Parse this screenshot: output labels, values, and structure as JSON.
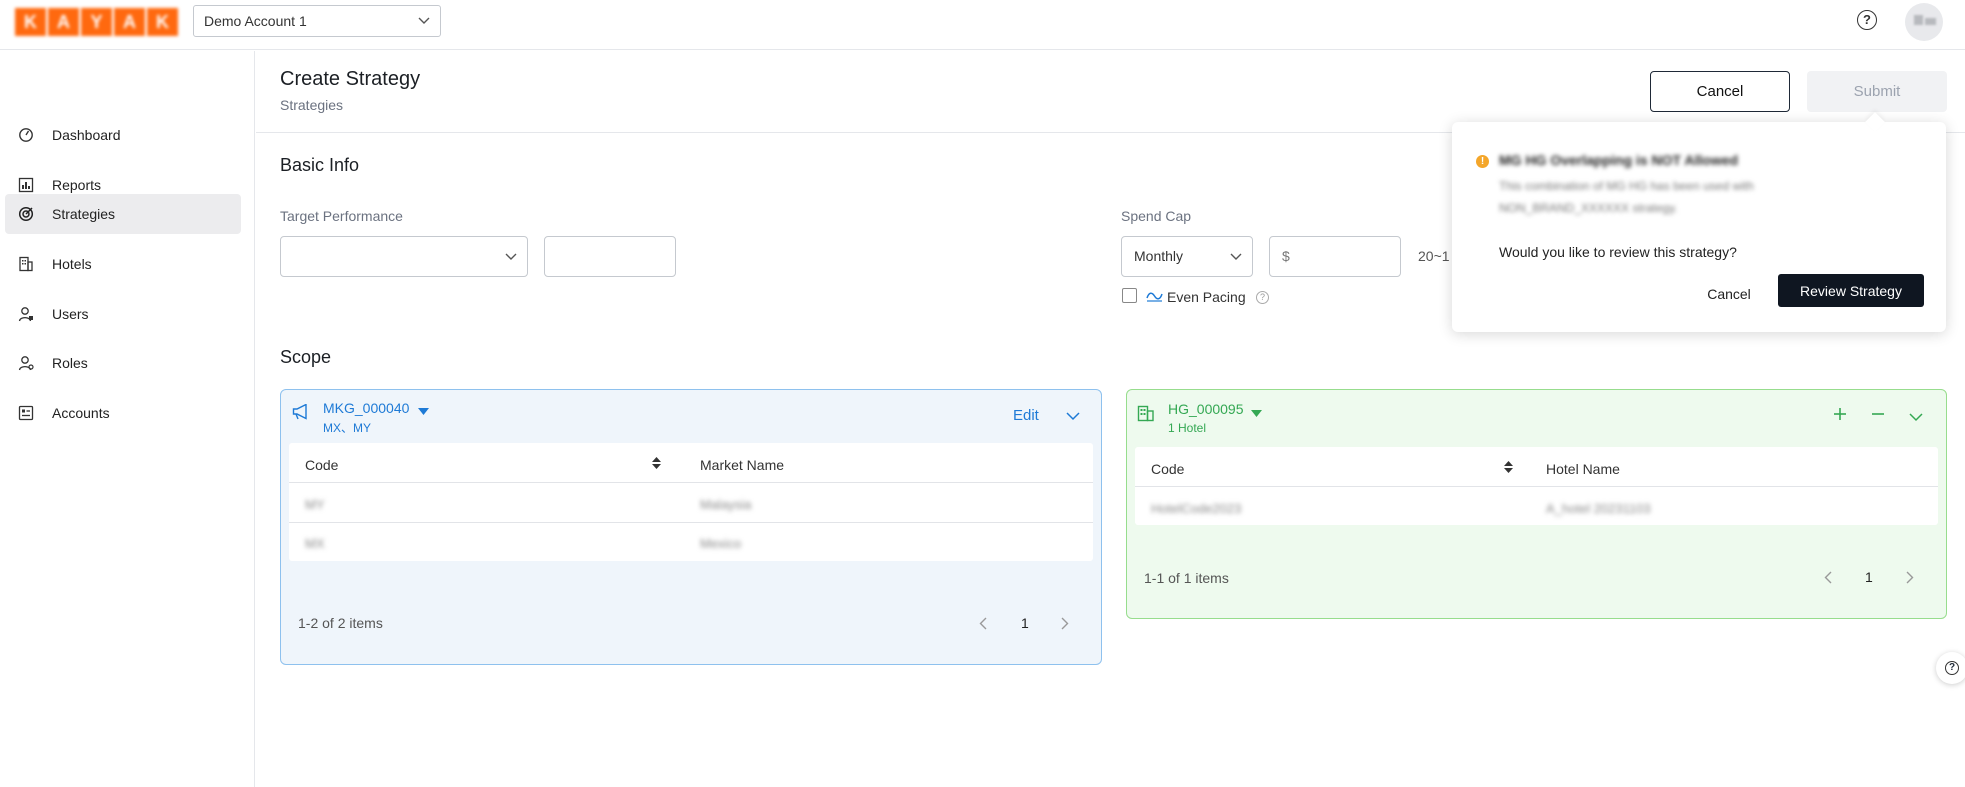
{
  "brand": {
    "logo_letters": [
      "K",
      "A",
      "Y",
      "A",
      "K"
    ],
    "accent": "#ff690f"
  },
  "header": {
    "account": "Demo Account 1",
    "help_icon": "question-circle-icon",
    "avatar_icon": "user-avatar-icon"
  },
  "sidebar": {
    "items": [
      {
        "label": "Dashboard",
        "icon": "dashboard-gauge-icon"
      },
      {
        "label": "Reports",
        "icon": "bar-chart-icon"
      },
      {
        "label": "Strategies",
        "icon": "target-icon",
        "active": true
      },
      {
        "label": "Hotels",
        "icon": "building-icon"
      },
      {
        "label": "Users",
        "icon": "user-icon"
      },
      {
        "label": "Roles",
        "icon": "user-role-icon"
      },
      {
        "label": "Accounts",
        "icon": "account-card-icon"
      }
    ]
  },
  "page": {
    "title": "Create Strategy",
    "breadcrumb": "Strategies",
    "cancel": "Cancel",
    "submit": "Submit"
  },
  "basic_info": {
    "title": "Basic Info",
    "target_performance_label": "Target Performance",
    "target_select_value": "",
    "target_input_value": "",
    "spend_cap_label": "Spend Cap",
    "spend_period": "Monthly",
    "spend_currency_placeholder": "$",
    "spend_range_hint": "20~1",
    "even_pacing_label": "Even Pacing"
  },
  "scope": {
    "title": "Scope",
    "market_group": {
      "code": "MKG_000040",
      "subtitle": "MX、MY",
      "edit": "Edit",
      "col_code": "Code",
      "col_name": "Market Name",
      "rows": [
        {
          "code": "MY",
          "name": "Malaysia"
        },
        {
          "code": "MX",
          "name": "Mexico"
        }
      ],
      "pager_summary": "1-2 of 2 items",
      "page": "1",
      "color": "#1e7ad6"
    },
    "hotel_group": {
      "code": "HG_000095",
      "subtitle": "1 Hotel",
      "col_code": "Code",
      "col_name": "Hotel Name",
      "rows": [
        {
          "code": "HotelCode2023",
          "name": "A_hotel 20231103"
        }
      ],
      "pager_summary": "1-1 of 1 items",
      "page": "1",
      "color": "#34a853"
    }
  },
  "popover": {
    "title": "MG HG Overlapping is NOT Allowed",
    "line1": "This combination of MG HG has been used with",
    "line2": "NON_BRAND_XXXXXX strategy.",
    "question": "Would you like to review this strategy?",
    "cancel": "Cancel",
    "review": "Review Strategy"
  }
}
